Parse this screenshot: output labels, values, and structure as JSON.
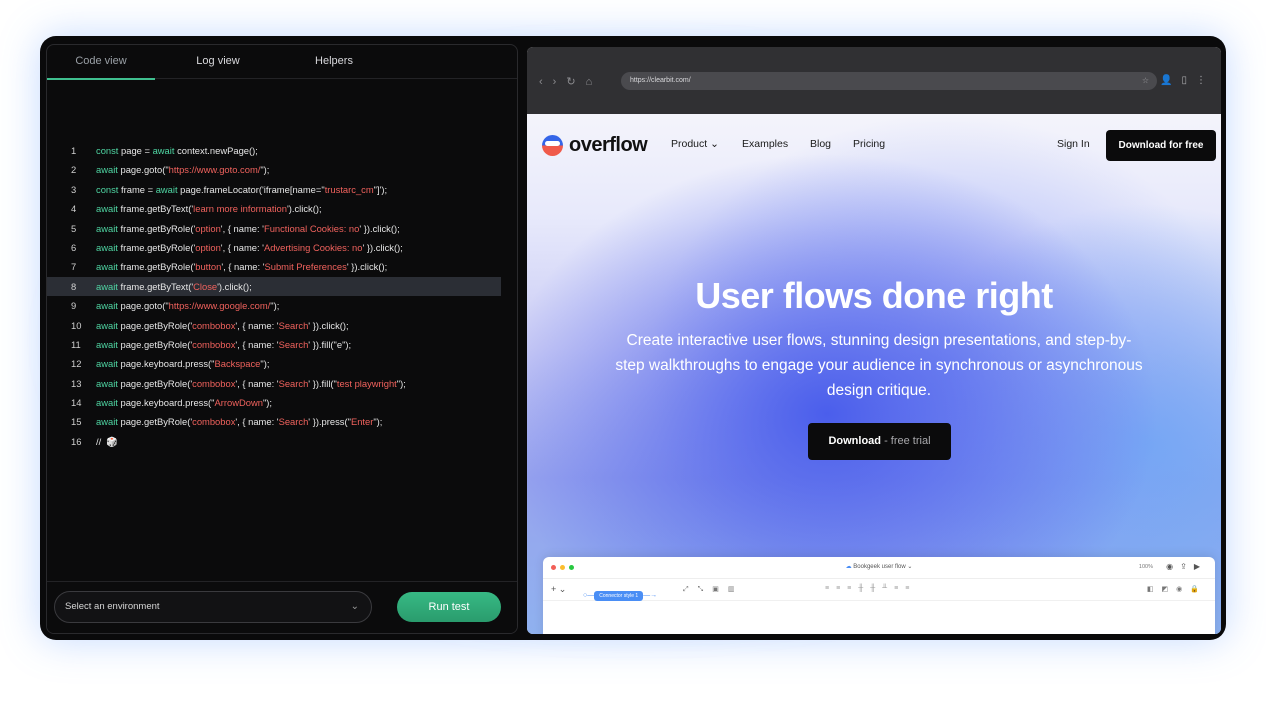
{
  "tabs": [
    "Code view",
    "Log view",
    "Helpers"
  ],
  "code_lines": [
    {
      "n": "1",
      "parts": [
        [
          "kw",
          "const"
        ],
        [
          "t",
          " page = "
        ],
        [
          "kw",
          "await"
        ],
        [
          "t",
          " context.newPage();"
        ]
      ]
    },
    {
      "n": "2",
      "parts": [
        [
          "kw",
          "await"
        ],
        [
          "t",
          " page.goto(\""
        ],
        [
          "str",
          "https://www.goto.com/"
        ],
        [
          "t",
          "\");"
        ]
      ]
    },
    {
      "n": "3",
      "parts": [
        [
          "kw",
          "const"
        ],
        [
          "t",
          " frame = "
        ],
        [
          "kw",
          "await"
        ],
        [
          "t",
          " page.frameLocator('iframe[name=\""
        ],
        [
          "str",
          "trustarc_cm"
        ],
        [
          "t",
          "\"]');"
        ]
      ]
    },
    {
      "n": "4",
      "parts": [
        [
          "kw",
          "await"
        ],
        [
          "t",
          " frame.getByText('"
        ],
        [
          "str",
          "learn more information"
        ],
        [
          "t",
          "').click();"
        ]
      ]
    },
    {
      "n": "5",
      "parts": [
        [
          "kw",
          "await"
        ],
        [
          "t",
          " frame.getByRole('"
        ],
        [
          "str",
          "option"
        ],
        [
          "t",
          "', { name: '"
        ],
        [
          "str",
          "Functional Cookies: no"
        ],
        [
          "t",
          "' }).click();"
        ]
      ]
    },
    {
      "n": "6",
      "parts": [
        [
          "kw",
          "await"
        ],
        [
          "t",
          " frame.getByRole('"
        ],
        [
          "str",
          "option"
        ],
        [
          "t",
          "', { name: '"
        ],
        [
          "str",
          "Advertising Cookies: no"
        ],
        [
          "t",
          "' }).click();"
        ]
      ]
    },
    {
      "n": "7",
      "parts": [
        [
          "kw",
          "await"
        ],
        [
          "t",
          " frame.getByRole('"
        ],
        [
          "str",
          "button"
        ],
        [
          "t",
          "', { name: '"
        ],
        [
          "str",
          "Submit Preferences"
        ],
        [
          "t",
          "' }).click();"
        ]
      ]
    },
    {
      "n": "8",
      "parts": [
        [
          "kw",
          "await"
        ],
        [
          "t",
          " frame.getByText('"
        ],
        [
          "str",
          "Close"
        ],
        [
          "t",
          "').click();"
        ]
      ]
    },
    {
      "n": "9",
      "parts": [
        [
          "kw",
          "await"
        ],
        [
          "t",
          " page.goto(\""
        ],
        [
          "str",
          "https://www.google.com/"
        ],
        [
          "t",
          "\");"
        ]
      ]
    },
    {
      "n": "10",
      "parts": [
        [
          "kw",
          "await"
        ],
        [
          "t",
          " page.getByRole('"
        ],
        [
          "str",
          "combobox"
        ],
        [
          "t",
          "', { name: '"
        ],
        [
          "str",
          "Search"
        ],
        [
          "t",
          "' }).click();"
        ]
      ]
    },
    {
      "n": "11",
      "parts": [
        [
          "kw",
          "await"
        ],
        [
          "t",
          " page.getByRole('"
        ],
        [
          "str",
          "combobox"
        ],
        [
          "t",
          "', { name: '"
        ],
        [
          "str",
          "Search"
        ],
        [
          "t",
          "' }).fill(\"e\");"
        ]
      ]
    },
    {
      "n": "12",
      "parts": [
        [
          "kw",
          "await"
        ],
        [
          "t",
          " page.keyboard.press(\""
        ],
        [
          "str",
          "Backspace"
        ],
        [
          "t",
          "\");"
        ]
      ]
    },
    {
      "n": "13",
      "parts": [
        [
          "kw",
          "await"
        ],
        [
          "t",
          " page.getByRole('"
        ],
        [
          "str",
          "combobox"
        ],
        [
          "t",
          "', { name: '"
        ],
        [
          "str",
          "Search"
        ],
        [
          "t",
          "' }).fill(\""
        ],
        [
          "str",
          "test playwright"
        ],
        [
          "t",
          "\");"
        ]
      ]
    },
    {
      "n": "14",
      "parts": [
        [
          "kw",
          "await"
        ],
        [
          "t",
          " page.keyboard.press(\""
        ],
        [
          "str",
          "ArrowDown"
        ],
        [
          "t",
          "\");"
        ]
      ]
    },
    {
      "n": "15",
      "parts": [
        [
          "kw",
          "await"
        ],
        [
          "t",
          " page.getByRole('"
        ],
        [
          "str",
          "combobox"
        ],
        [
          "t",
          "', { name: '"
        ],
        [
          "str",
          "Search"
        ],
        [
          "t",
          "' }).press(\""
        ],
        [
          "str",
          "Enter"
        ],
        [
          "t",
          "\");"
        ]
      ]
    },
    {
      "n": "16",
      "parts": [
        [
          "t",
          "//  🎲"
        ]
      ]
    }
  ],
  "highlighted_line": "8",
  "env_select_label": "Select an environment",
  "run_button": "Run test",
  "browser": {
    "url": "https://clearbit.com/"
  },
  "site": {
    "logo": "overflow",
    "nav": [
      "Product",
      "Examples",
      "Blog",
      "Pricing"
    ],
    "sign_in": "Sign In",
    "cta": "Download for free",
    "hero_title": "User flows done right",
    "hero_sub": "Create interactive user flows, stunning design presentations, and step-by-step walkthroughs to engage your audience in synchronous or asynchronous design critique.",
    "hero_btn_main": "Download",
    "hero_btn_muted": " - free trial",
    "app_title": "Bookgeek user flow",
    "app_zoom": "100%",
    "connector_label": "Connector style 1"
  },
  "colors": {
    "keyword": "#4fd6a3",
    "string": "#f0625d",
    "accent": "#3fbf8f"
  }
}
